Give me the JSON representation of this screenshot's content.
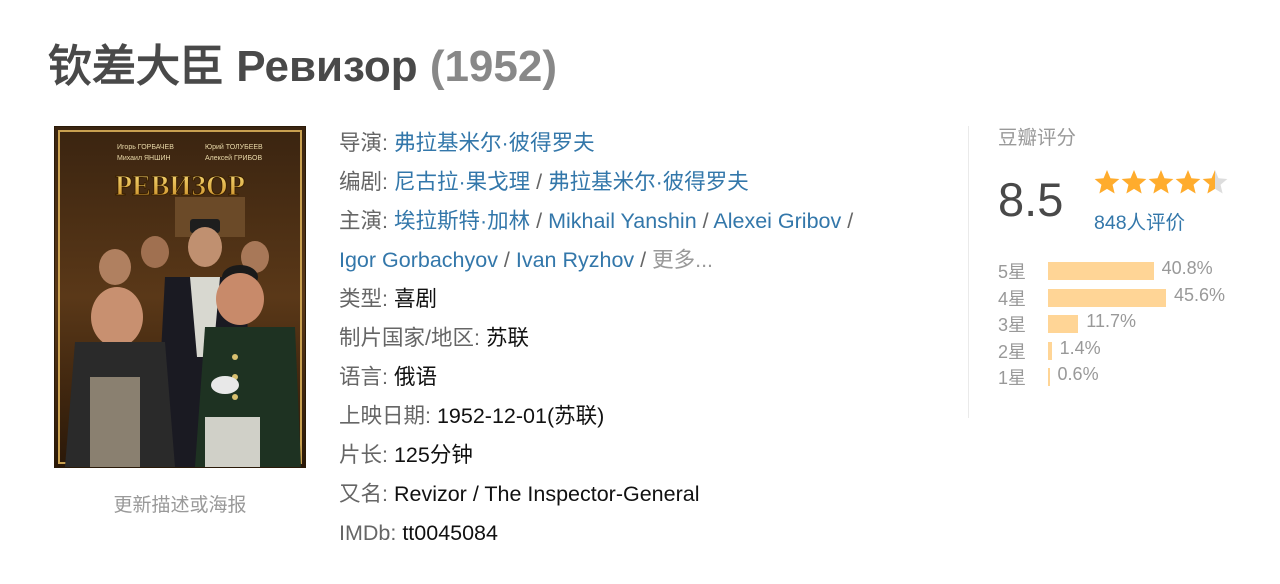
{
  "title": {
    "name": "钦差大臣 Ревизор",
    "year": "(1952)"
  },
  "poster": {
    "cast_left": "Игорь ГОРБАЧЕВ",
    "cast_left2": "Михаил ЯНШИН",
    "cast_right": "Юрий ТОЛУБЕЕВ",
    "cast_right2": "Алексей ГРИБОВ",
    "poster_title": "РЕВИЗОР"
  },
  "update_link": "更新描述或海报",
  "info": {
    "director_label": "导演",
    "director": "弗拉基米尔·彼得罗夫",
    "writer_label": "编剧",
    "writers": [
      "尼古拉·果戈理",
      "弗拉基米尔·彼得罗夫"
    ],
    "cast_label": "主演",
    "cast": [
      "埃拉斯特·加林",
      "Mikhail Yanshin",
      "Alexei Gribov",
      "Igor Gorbachyov",
      "Ivan Ryzhov"
    ],
    "more": "更多...",
    "genre_label": "类型:",
    "genre": "喜剧",
    "country_label": "制片国家/地区:",
    "country": "苏联",
    "language_label": "语言:",
    "language": "俄语",
    "release_label": "上映日期:",
    "release": "1952-12-01(苏联)",
    "runtime_label": "片长:",
    "runtime": "125分钟",
    "aka_label": "又名:",
    "aka": "Revizor / The Inspector-General",
    "imdb_label": "IMDb:",
    "imdb": "tt0045084"
  },
  "rating": {
    "title": "豆瓣评分",
    "score": "8.5",
    "stars": 4.5,
    "votes": "848人评价",
    "accent": "#ffac2d",
    "bar_color": "#ffd596",
    "distribution": [
      {
        "label": "5星",
        "percent": "40.8%",
        "value": 40.8
      },
      {
        "label": "4星",
        "percent": "45.6%",
        "value": 45.6
      },
      {
        "label": "3星",
        "percent": "11.7%",
        "value": 11.7
      },
      {
        "label": "2星",
        "percent": "1.4%",
        "value": 1.4
      },
      {
        "label": "1星",
        "percent": "0.6%",
        "value": 0.6
      }
    ]
  }
}
